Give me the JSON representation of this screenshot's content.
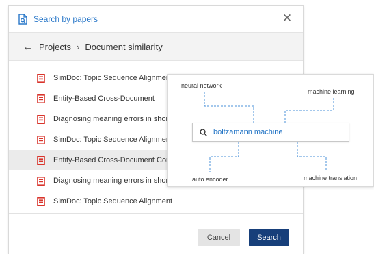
{
  "dialog": {
    "title": "Search by papers",
    "breadcrumb": {
      "root": "Projects",
      "separator": "›",
      "current": "Document similarity"
    },
    "icons": {
      "header": "document-search-icon",
      "close": "close-icon",
      "back": "back-arrow-icon",
      "file": "pdf-file-icon"
    },
    "items": [
      {
        "label": "SimDoc: Topic Sequence Alignment based Document",
        "selected": false
      },
      {
        "label": "Entity-Based Cross-Document",
        "selected": false
      },
      {
        "label": "Diagnosing meaning errors in shor",
        "selected": false
      },
      {
        "label": "SimDoc: Topic Sequence Alignmer",
        "selected": false
      },
      {
        "label": "Entity-Based Cross-Document Core",
        "selected": true
      },
      {
        "label": "Diagnosing meaning errors in shor",
        "selected": false
      },
      {
        "label": "SimDoc: Topic Sequence Alignment",
        "selected": false
      }
    ],
    "buttons": {
      "cancel": "Cancel",
      "search": "Search"
    }
  },
  "keyword_map": {
    "query": "boltzamann machine",
    "keywords": {
      "top_left": "neural network",
      "top_right": "machine learning",
      "bottom_left": "auto encoder",
      "bottom_right": "machine translation"
    }
  },
  "colors": {
    "accent": "#2a78c9",
    "search_button": "#173f7a",
    "pdf_icon": "#d9342b",
    "connector": "#4a90d9"
  }
}
